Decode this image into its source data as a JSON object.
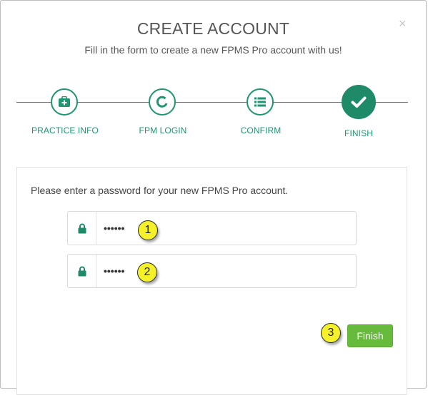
{
  "dialog": {
    "title": "CREATE ACCOUNT",
    "subtitle": "Fill in the form to create a new FPMS Pro account with us!",
    "close_glyph": "×"
  },
  "steps": [
    {
      "label": "PRACTICE INFO",
      "icon": "medkit-icon"
    },
    {
      "label": "FPM LOGIN",
      "icon": "login-spinner-icon"
    },
    {
      "label": "CONFIRM",
      "icon": "list-icon"
    },
    {
      "label": "FINISH",
      "icon": "check-icon",
      "active": true
    }
  ],
  "form": {
    "prompt": "Please enter a password for your new FPMS Pro account.",
    "password_value": "••••••",
    "confirm_password_value": "••••••",
    "finish_label": "Finish"
  },
  "annotations": [
    "1",
    "2",
    "3"
  ],
  "colors": {
    "accent": "#1e9670",
    "active_step": "#1e8a68",
    "finish_button": "#66bb3c",
    "callout": "#f4f128"
  }
}
